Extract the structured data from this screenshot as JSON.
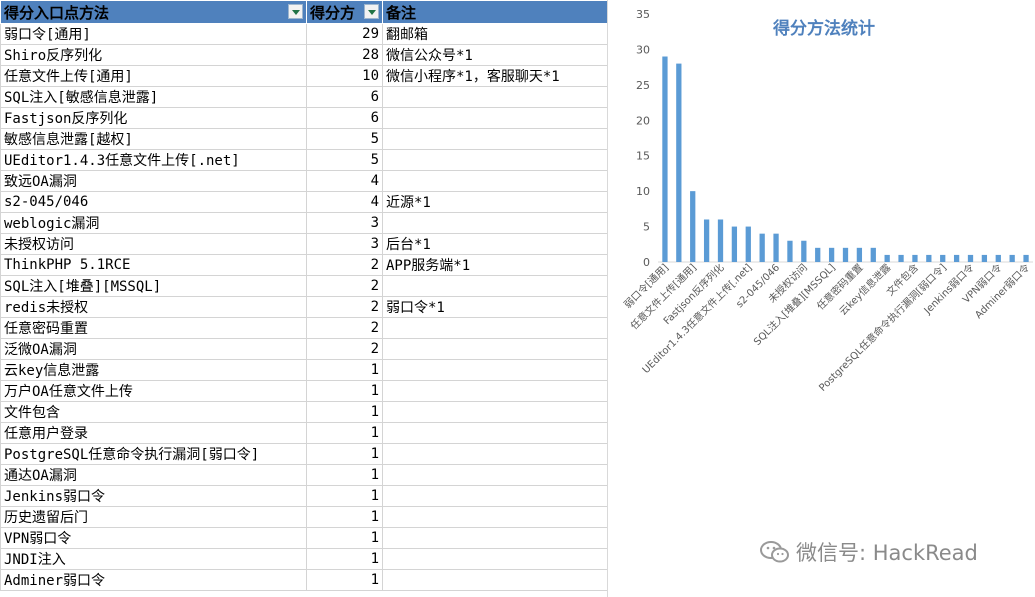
{
  "table": {
    "headers": [
      "得分入口点方法",
      "得分方",
      "备注"
    ],
    "rows": [
      [
        "弱口令[通用]",
        "29",
        "翻邮箱"
      ],
      [
        "Shiro反序列化",
        "28",
        "微信公众号*1"
      ],
      [
        "任意文件上传[通用]",
        "10",
        "微信小程序*1，客服聊天*1"
      ],
      [
        "SQL注入[敏感信息泄露]",
        "6",
        ""
      ],
      [
        "Fastjson反序列化",
        "6",
        ""
      ],
      [
        "敏感信息泄露[越权]",
        "5",
        ""
      ],
      [
        "UEditor1.4.3任意文件上传[.net]",
        "5",
        ""
      ],
      [
        "致远OA漏洞",
        "4",
        ""
      ],
      [
        "s2-045/046",
        "4",
        "近源*1"
      ],
      [
        "weblogic漏洞",
        "3",
        ""
      ],
      [
        "未授权访问",
        "3",
        "后台*1"
      ],
      [
        "ThinkPHP 5.1RCE",
        "2",
        "APP服务端*1"
      ],
      [
        "SQL注入[堆叠][MSSQL]",
        "2",
        ""
      ],
      [
        "redis未授权",
        "2",
        "弱口令*1"
      ],
      [
        "任意密码重置",
        "2",
        ""
      ],
      [
        "泛微OA漏洞",
        "2",
        ""
      ],
      [
        "云key信息泄露",
        "1",
        ""
      ],
      [
        "万户OA任意文件上传",
        "1",
        ""
      ],
      [
        "文件包含",
        "1",
        ""
      ],
      [
        "任意用户登录",
        "1",
        ""
      ],
      [
        "PostgreSQL任意命令执行漏洞[弱口令]",
        "1",
        ""
      ],
      [
        "通达OA漏洞",
        "1",
        ""
      ],
      [
        "Jenkins弱口令",
        "1",
        ""
      ],
      [
        "历史遗留后门",
        "1",
        ""
      ],
      [
        "VPN弱口令",
        "1",
        ""
      ],
      [
        "JNDI注入",
        "1",
        ""
      ],
      [
        "Adminer弱口令",
        "1",
        ""
      ]
    ]
  },
  "chart_data": {
    "type": "bar",
    "title": "得分方法统计",
    "categories": [
      "弱口令[通用]",
      "Shiro反序列化",
      "任意文件上传[通用]",
      "SQL注入[敏感信息泄露]",
      "Fastjson反序列化",
      "敏感信息泄露[越权]",
      "UEditor1.4.3任意文件上传[.net]",
      "致远OA漏洞",
      "s2-045/046",
      "weblogic漏洞",
      "未授权访问",
      "ThinkPHP 5.1RCE",
      "SQL注入[堆叠][MSSQL]",
      "redis未授权",
      "任意密码重置",
      "泛微OA漏洞",
      "云key信息泄露",
      "万户OA任意文件上传",
      "文件包含",
      "任意用户登录",
      "PostgreSQL任意命令执行漏洞[弱口令]",
      "通达OA漏洞",
      "Jenkins弱口令",
      "历史遗留后门",
      "VPN弱口令",
      "JNDI注入",
      "Adminer弱口令"
    ],
    "values": [
      29,
      28,
      10,
      6,
      6,
      5,
      5,
      4,
      4,
      3,
      3,
      2,
      2,
      2,
      2,
      2,
      1,
      1,
      1,
      1,
      1,
      1,
      1,
      1,
      1,
      1,
      1
    ],
    "shown_labels": [
      "弱口令[通用]",
      "",
      "任意文件上传[通用]",
      "",
      "Fastjson反序列化",
      "",
      "UEditor1.4.3任意文件上传[.net]",
      "",
      "s2-045/046",
      "",
      "未授权访问",
      "",
      "SQL注入[堆叠][MSSQL]",
      "",
      "任意密码重置",
      "",
      "云key信息泄露",
      "",
      "文件包含",
      "",
      "PostgreSQL任意命令执行漏洞[弱口令]",
      "",
      "Jenkins弱口令",
      "",
      "VPN弱口令",
      "",
      "Adminer弱口令"
    ],
    "yticks": [
      0,
      5,
      10,
      15,
      20,
      25,
      30,
      35
    ],
    "ylim": [
      0,
      35
    ],
    "grid": false,
    "legend": "none",
    "bar_color": "#5b9bd5"
  },
  "watermark": {
    "text": "微信号: HackRead",
    "icon": "wechat-icon"
  },
  "colors": {
    "header_bg": "#4f81bd",
    "title": "#4f81bd",
    "bar": "#5b9bd5"
  }
}
